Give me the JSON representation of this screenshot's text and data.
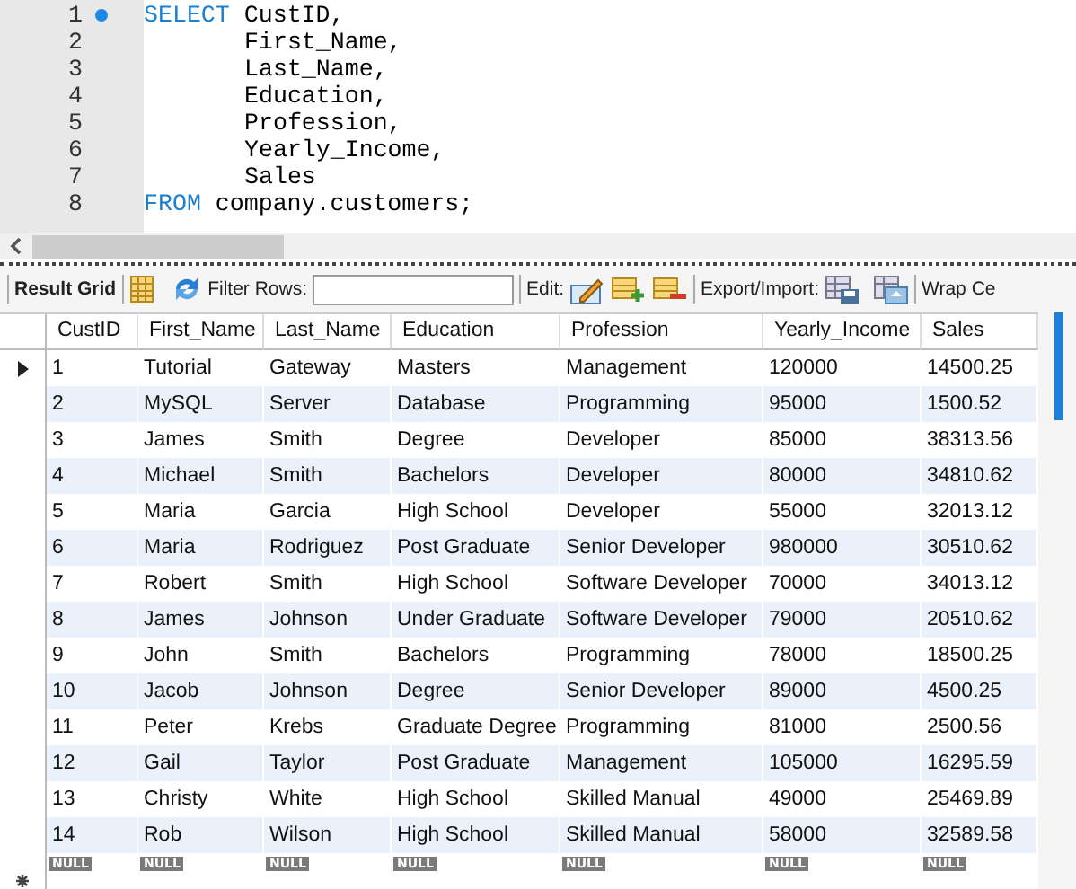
{
  "editor": {
    "lines": [
      {
        "number": "1",
        "keyword": "SELECT",
        "code": "CustID,",
        "marked": true
      },
      {
        "number": "2",
        "code": "First_Name,",
        "marked": false
      },
      {
        "number": "3",
        "code": "Last_Name,",
        "marked": false
      },
      {
        "number": "4",
        "code": "Education,",
        "marked": false
      },
      {
        "number": "5",
        "code": "Profession,",
        "marked": false
      },
      {
        "number": "6",
        "code": "Yearly_Income,",
        "marked": false
      },
      {
        "number": "7",
        "code": "Sales",
        "marked": false
      },
      {
        "number": "8",
        "keyword": "FROM",
        "code": "company.customers;",
        "marked": false
      }
    ]
  },
  "toolbar": {
    "result_grid": "Result Grid",
    "filter_label": "Filter Rows:",
    "edit_label": "Edit:",
    "export_label": "Export/Import:",
    "wrap_label": "Wrap Ce"
  },
  "table": {
    "columns": [
      "CustID",
      "First_Name",
      "Last_Name",
      "Education",
      "Profession",
      "Yearly_Income",
      "Sales"
    ],
    "rows": [
      {
        "current": true,
        "cells": [
          "1",
          "Tutorial",
          "Gateway",
          "Masters",
          "Management",
          "120000",
          "14500.25"
        ]
      },
      {
        "current": false,
        "cells": [
          "2",
          "MySQL",
          "Server",
          "Database",
          "Programming",
          "95000",
          "1500.52"
        ]
      },
      {
        "current": false,
        "cells": [
          "3",
          "James",
          "Smith",
          "Degree",
          "Developer",
          "85000",
          "38313.56"
        ]
      },
      {
        "current": false,
        "cells": [
          "4",
          "Michael",
          "Smith",
          "Bachelors",
          "Developer",
          "80000",
          "34810.62"
        ]
      },
      {
        "current": false,
        "cells": [
          "5",
          "Maria",
          "Garcia",
          "High School",
          "Developer",
          "55000",
          "32013.12"
        ]
      },
      {
        "current": false,
        "cells": [
          "6",
          "Maria",
          "Rodriguez",
          "Post Graduate",
          "Senior Developer",
          "980000",
          "30510.62"
        ]
      },
      {
        "current": false,
        "cells": [
          "7",
          "Robert",
          "Smith",
          "High School",
          "Software Developer",
          "70000",
          "34013.12"
        ]
      },
      {
        "current": false,
        "cells": [
          "8",
          "James",
          "Johnson",
          "Under Graduate",
          "Software Developer",
          "79000",
          "20510.62"
        ]
      },
      {
        "current": false,
        "cells": [
          "9",
          "John",
          "Smith",
          "Bachelors",
          "Programming",
          "78000",
          "18500.25"
        ]
      },
      {
        "current": false,
        "cells": [
          "10",
          "Jacob",
          "Johnson",
          "Degree",
          "Senior Developer",
          "89000",
          "4500.25"
        ]
      },
      {
        "current": false,
        "cells": [
          "11",
          "Peter",
          "Krebs",
          "Graduate Degree",
          "Programming",
          "81000",
          "2500.56"
        ]
      },
      {
        "current": false,
        "cells": [
          "12",
          "Gail",
          "Taylor",
          "Post Graduate",
          "Management",
          "105000",
          "16295.59"
        ]
      },
      {
        "current": false,
        "cells": [
          "13",
          "Christy",
          "White",
          "High School",
          "Skilled Manual",
          "49000",
          "25469.89"
        ]
      },
      {
        "current": false,
        "cells": [
          "14",
          "Rob",
          "Wilson",
          "High School",
          "Skilled Manual",
          "58000",
          "32589.58"
        ]
      }
    ],
    "new_row": [
      "NULL",
      "NULL",
      "NULL",
      "NULL",
      "NULL",
      "NULL",
      "NULL"
    ]
  }
}
